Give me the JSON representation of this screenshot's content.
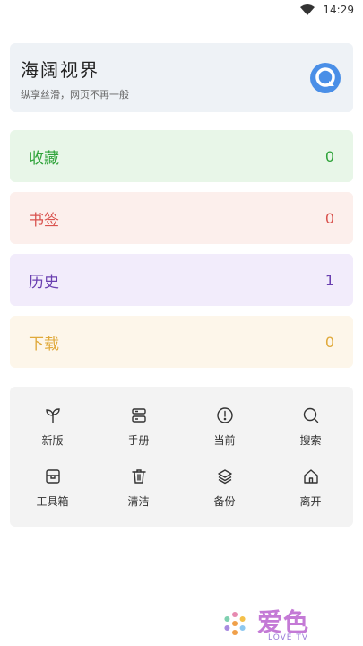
{
  "status": {
    "time": "14:29"
  },
  "hero": {
    "title": "海阔视界",
    "subtitle": "纵享丝滑，网页不再一般",
    "icon": "search-bubble-icon",
    "accent": "#4a8fe7"
  },
  "cards": [
    {
      "label": "收藏",
      "count": "0",
      "color": "#2fa33a"
    },
    {
      "label": "书签",
      "count": "0",
      "color": "#d9534f"
    },
    {
      "label": "历史",
      "count": "1",
      "color": "#6a3fb0"
    },
    {
      "label": "下载",
      "count": "0",
      "color": "#e0a93a"
    }
  ],
  "tools": [
    {
      "label": "新版",
      "icon": "sprout-icon"
    },
    {
      "label": "手册",
      "icon": "book-stack-icon"
    },
    {
      "label": "当前",
      "icon": "alert-circle-icon"
    },
    {
      "label": "搜索",
      "icon": "search-icon"
    },
    {
      "label": "工具箱",
      "icon": "toolbox-icon"
    },
    {
      "label": "清洁",
      "icon": "trash-icon"
    },
    {
      "label": "备份",
      "icon": "layers-icon"
    },
    {
      "label": "离开",
      "icon": "home-icon"
    }
  ],
  "logo": {
    "brand": "爱色",
    "sub": "LOVE TV"
  }
}
